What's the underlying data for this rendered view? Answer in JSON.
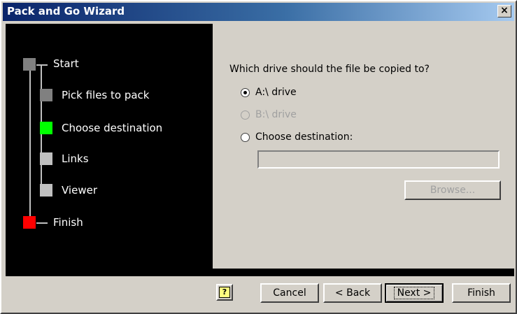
{
  "window": {
    "title": "Pack and Go Wizard",
    "close_glyph": "×"
  },
  "steps": [
    {
      "label": "Start",
      "color": "#808080"
    },
    {
      "label": "Pick files to pack",
      "color": "#808080"
    },
    {
      "label": "Choose destination",
      "color": "#00ff00"
    },
    {
      "label": "Links",
      "color": "#c0c0c0"
    },
    {
      "label": "Viewer",
      "color": "#c0c0c0"
    },
    {
      "label": "Finish",
      "color": "#ff0000"
    }
  ],
  "main": {
    "question": "Which drive should the file be copied to?",
    "options": [
      {
        "label": "A:\\ drive",
        "selected": true,
        "enabled": true
      },
      {
        "label": "B:\\ drive",
        "selected": false,
        "enabled": false
      },
      {
        "label": "Choose destination:",
        "selected": false,
        "enabled": true
      }
    ],
    "destination_value": "",
    "browse_label": "Browse..."
  },
  "footer": {
    "help_icon": "help-icon",
    "help_glyph": "?",
    "cancel_label": "Cancel",
    "back_label": "< Back",
    "next_label": "Next >",
    "finish_label": "Finish"
  }
}
